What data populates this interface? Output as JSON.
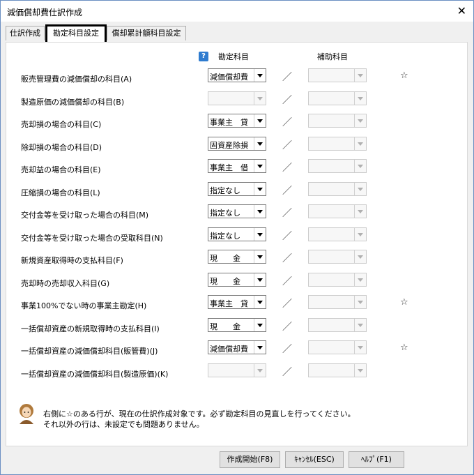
{
  "window": {
    "title": "減価償却費仕訳作成",
    "close_label": "✕"
  },
  "tabs": [
    {
      "label": "仕訳作成"
    },
    {
      "label": "勘定科目設定"
    },
    {
      "label": "償却累計額科目設定"
    }
  ],
  "headers": {
    "help": "?",
    "account": "勘定科目",
    "sub_account": "補助科目"
  },
  "rows": [
    {
      "label": "販売管理費の減価償却の科目(A)",
      "account": "減価償却費",
      "enabled": true,
      "slash": "／",
      "star": "☆"
    },
    {
      "label": "製造原価の減価償却の科目(B)",
      "account": "",
      "enabled": false,
      "slash": "／",
      "star": ""
    },
    {
      "label": "売却損の場合の科目(C)",
      "account": "事業主　貸",
      "enabled": true,
      "slash": "／",
      "star": ""
    },
    {
      "label": "除却損の場合の科目(D)",
      "account": "固資産除損",
      "enabled": true,
      "slash": "／",
      "star": ""
    },
    {
      "label": "売却益の場合の科目(E)",
      "account": "事業主　借",
      "enabled": true,
      "slash": "／",
      "star": ""
    },
    {
      "label": "圧縮損の場合の科目(L)",
      "account": "指定なし",
      "enabled": true,
      "slash": "／",
      "star": ""
    },
    {
      "label": "交付金等を受け取った場合の科目(M)",
      "account": "指定なし",
      "enabled": true,
      "slash": "／",
      "star": ""
    },
    {
      "label": "交付金等を受け取った場合の受取科目(N)",
      "account": "指定なし",
      "enabled": true,
      "slash": "／",
      "star": ""
    },
    {
      "label": "新規資産取得時の支払科目(F)",
      "account": "現　　金",
      "enabled": true,
      "slash": "／",
      "star": ""
    },
    {
      "label": "売却時の売却収入科目(G)",
      "account": "現　　金",
      "enabled": true,
      "slash": "／",
      "star": ""
    },
    {
      "label": "事業100%でない時の事業主勘定(H)",
      "account": "事業主　貸",
      "enabled": true,
      "slash": "／",
      "star": "☆"
    },
    {
      "label": "一括償却資産の新規取得時の支払科目(I)",
      "account": "現　　金",
      "enabled": true,
      "slash": "／",
      "star": ""
    },
    {
      "label": "一括償却資産の減価償却科目(販管費)(J)",
      "account": "減価償却費",
      "enabled": true,
      "slash": "／",
      "star": "☆"
    },
    {
      "label": "一括償却資産の減価償却科目(製造原価)(K)",
      "account": "",
      "enabled": false,
      "slash": "／",
      "star": ""
    }
  ],
  "note": {
    "line1": "右側に☆のある行が、現在の仕訳作成対象です。必ず勘定科目の見直しを行ってください。",
    "line2": "それ以外の行は、未設定でも問題ありません。"
  },
  "buttons": {
    "start": "作成開始(F8)",
    "cancel": "ｷｬﾝｾﾙ(ESC)",
    "help": "ﾍﾙﾌﾟ(F1)"
  }
}
